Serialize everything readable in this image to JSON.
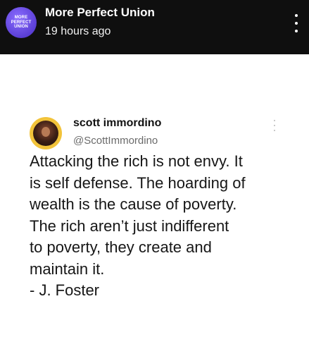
{
  "header": {
    "channel_name": "More Perfect Union",
    "time_ago": "19 hours ago",
    "avatar_text": [
      "MORE",
      "PERFECT",
      "UNION"
    ]
  },
  "tweet": {
    "display_name": "scott immordino",
    "handle": "@ScottImmordino",
    "text": "Attacking the rich is not envy. It\nis self defense. The hoarding of\nwealth is the cause of poverty.\nThe rich aren’t just indifferent\nto poverty, they create and\nmaintain it.\n- J. Foster"
  },
  "colors": {
    "header_bg": "#0f0f0f",
    "avatar_purple": "#5b3fd6",
    "tweet_avatar_ring": "#f2c33a"
  },
  "icons": [
    "more-vertical-icon",
    "tweet-more-icon"
  ]
}
